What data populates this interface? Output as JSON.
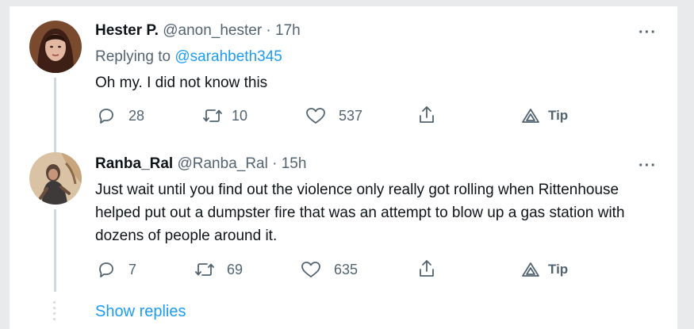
{
  "tweets": [
    {
      "name": "Hester P.",
      "meta": "@anon_hester · 17h",
      "replying_label": "Replying to",
      "replying_handle": "@sarahbeth345",
      "text": "Oh my. I did not know this",
      "replies": "28",
      "retweets": "10",
      "likes": "537",
      "tip": "Tip"
    },
    {
      "name": "Ranba_Ral",
      "meta": "@Ranba_Ral · 15h",
      "text": "Just wait until you find out the violence only really got rolling when Rittenhouse helped put out a dumpster fire that was an attempt to blow up a gas station with dozens of people around it.",
      "replies": "7",
      "retweets": "69",
      "likes": "635",
      "tip": "Tip"
    }
  ],
  "show_replies": "Show replies",
  "colors": {
    "link": "#1d9bf0",
    "secondary": "#536471",
    "thread_line": "#cfd9de"
  },
  "icons": [
    "reply-icon",
    "retweet-icon",
    "like-icon",
    "share-icon",
    "tip-icon",
    "more-icon"
  ]
}
